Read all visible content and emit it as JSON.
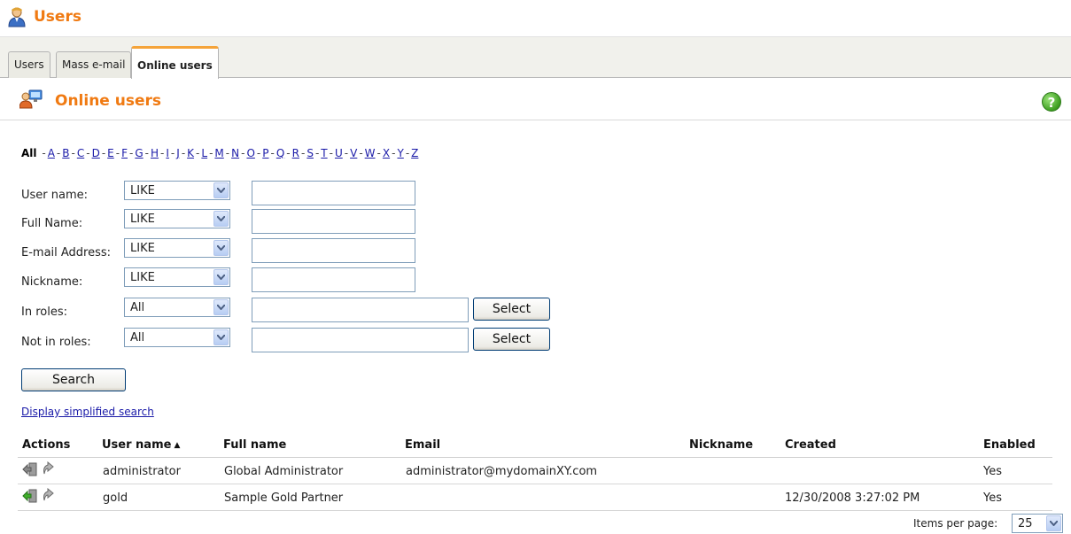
{
  "header": {
    "title": "Users",
    "icon": "user-icon",
    "title_color": "#f07a12"
  },
  "tabs": [
    {
      "label": "Users",
      "active": false
    },
    {
      "label": "Mass e-mail",
      "active": false
    },
    {
      "label": "Online users",
      "active": true
    }
  ],
  "section": {
    "title": "Online users",
    "icon": "online-users-icon",
    "help_icon": "help-icon",
    "help_glyph": "?"
  },
  "alphabet": {
    "all": "All",
    "letters": [
      "A",
      "B",
      "C",
      "D",
      "E",
      "F",
      "G",
      "H",
      "I",
      "J",
      "K",
      "L",
      "M",
      "N",
      "O",
      "P",
      "Q",
      "R",
      "S",
      "T",
      "U",
      "V",
      "W",
      "X",
      "Y",
      "Z"
    ]
  },
  "filters": [
    {
      "label": "User name:",
      "operator": "LIKE",
      "value": ""
    },
    {
      "label": "Full Name:",
      "operator": "LIKE",
      "value": ""
    },
    {
      "label": "E-mail Address:",
      "operator": "LIKE",
      "value": ""
    },
    {
      "label": "Nickname:",
      "operator": "LIKE",
      "value": ""
    },
    {
      "label": "In roles:",
      "operator": "All",
      "value": "",
      "button": "Select"
    },
    {
      "label": "Not in roles:",
      "operator": "All",
      "value": "",
      "button": "Select"
    }
  ],
  "search_button": "Search",
  "simplified_link": "Display simplified search",
  "grid": {
    "columns": {
      "actions": "Actions",
      "username": "User name",
      "sort_indicator": "▲",
      "fullname": "Full name",
      "email": "Email",
      "nickname": "Nickname",
      "created": "Created",
      "enabled": "Enabled"
    },
    "rows": [
      {
        "username": "administrator",
        "fullname": "Global Administrator",
        "email": "administrator@mydomainXY.com",
        "nickname": "",
        "created": "",
        "enabled": "Yes"
      },
      {
        "username": "gold",
        "fullname": "Sample Gold Partner",
        "email": "",
        "nickname": "",
        "created": "12/30/2008 3:27:02 PM",
        "enabled": "Yes"
      }
    ]
  },
  "pager": {
    "label": "Items per page:",
    "value": "25"
  }
}
